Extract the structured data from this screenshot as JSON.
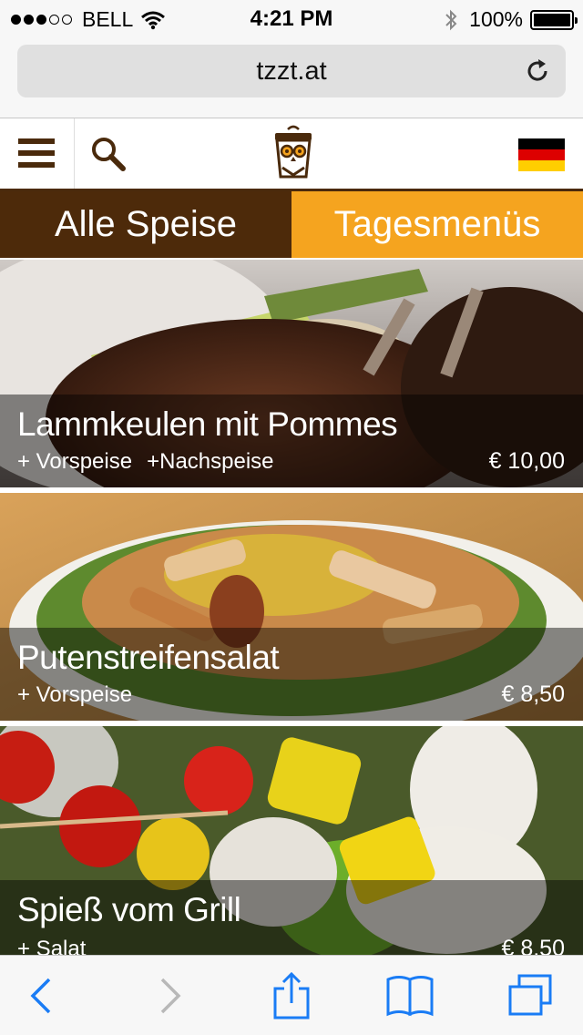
{
  "status_bar": {
    "carrier": "BELL",
    "time": "4:21 PM",
    "battery": "100%"
  },
  "browser": {
    "url": "tzzt.at"
  },
  "header": {
    "menu_icon": "hamburger-menu-icon",
    "search_icon": "search-icon",
    "logo_icon": "owl-chef-logo",
    "language_icon": "german-flag-icon"
  },
  "tabs": [
    {
      "label": "Alle Speise",
      "active": true
    },
    {
      "label": "Tagesmenüs",
      "active": false
    }
  ],
  "menu_items": [
    {
      "title": "Lammkeulen mit Pommes",
      "extras": [
        "+ Vorspeise",
        "+Nachspeise"
      ],
      "price": "€ 10,00"
    },
    {
      "title": "Putenstreifensalat",
      "extras": [
        "+ Vorspeise"
      ],
      "price": "€ 8,50"
    },
    {
      "title": "Spieß vom Grill",
      "extras": [
        "+ Salat"
      ],
      "price": "€ 8,50"
    }
  ],
  "colors": {
    "brand_brown": "#4d2a0a",
    "brand_orange": "#f5a41f",
    "ios_blue": "#1a7cf5"
  }
}
